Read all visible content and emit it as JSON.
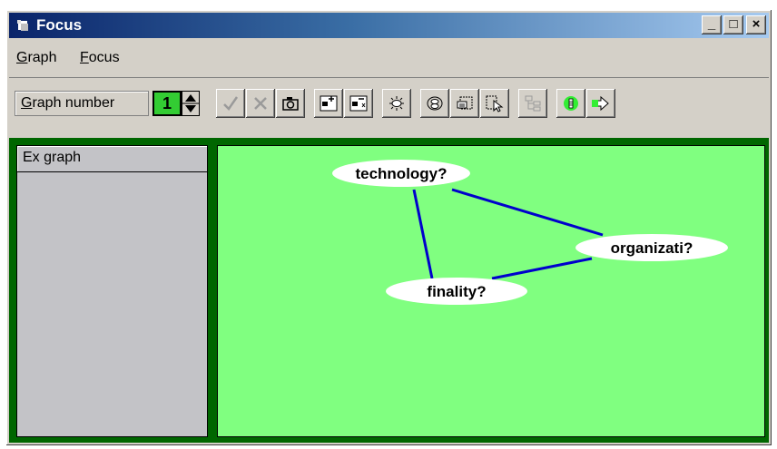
{
  "window": {
    "title": "Focus",
    "title_icon": "app-icon"
  },
  "titlebar_buttons": {
    "minimize": "_",
    "maximize": "□",
    "close": "×"
  },
  "menu": {
    "items": [
      {
        "label": "Graph",
        "accel": "G"
      },
      {
        "label": "Focus",
        "accel": "F"
      }
    ]
  },
  "toolbar": {
    "graph_number_label": "Graph number",
    "graph_number_value": "1",
    "tools": [
      "check-icon",
      "cross-icon",
      "camera-icon",
      "add-node-icon",
      "remove-node-icon",
      "explode-icon",
      "group-icon",
      "select-box-icon",
      "pointer-icon",
      "tree-icon",
      "focus-green-icon",
      "arrow-right-icon"
    ]
  },
  "left_panel": {
    "header": "Ex graph"
  },
  "graph": {
    "nodes": [
      {
        "id": "technology",
        "label": "technology?"
      },
      {
        "id": "organization",
        "label": "organizati?"
      },
      {
        "id": "finality",
        "label": "finality?"
      }
    ],
    "edges": [
      {
        "from": "technology",
        "to": "organization"
      },
      {
        "from": "technology",
        "to": "finality"
      },
      {
        "from": "finality",
        "to": "organization"
      }
    ],
    "edge_color": "#0000cc",
    "background_color": "#80ff80"
  }
}
